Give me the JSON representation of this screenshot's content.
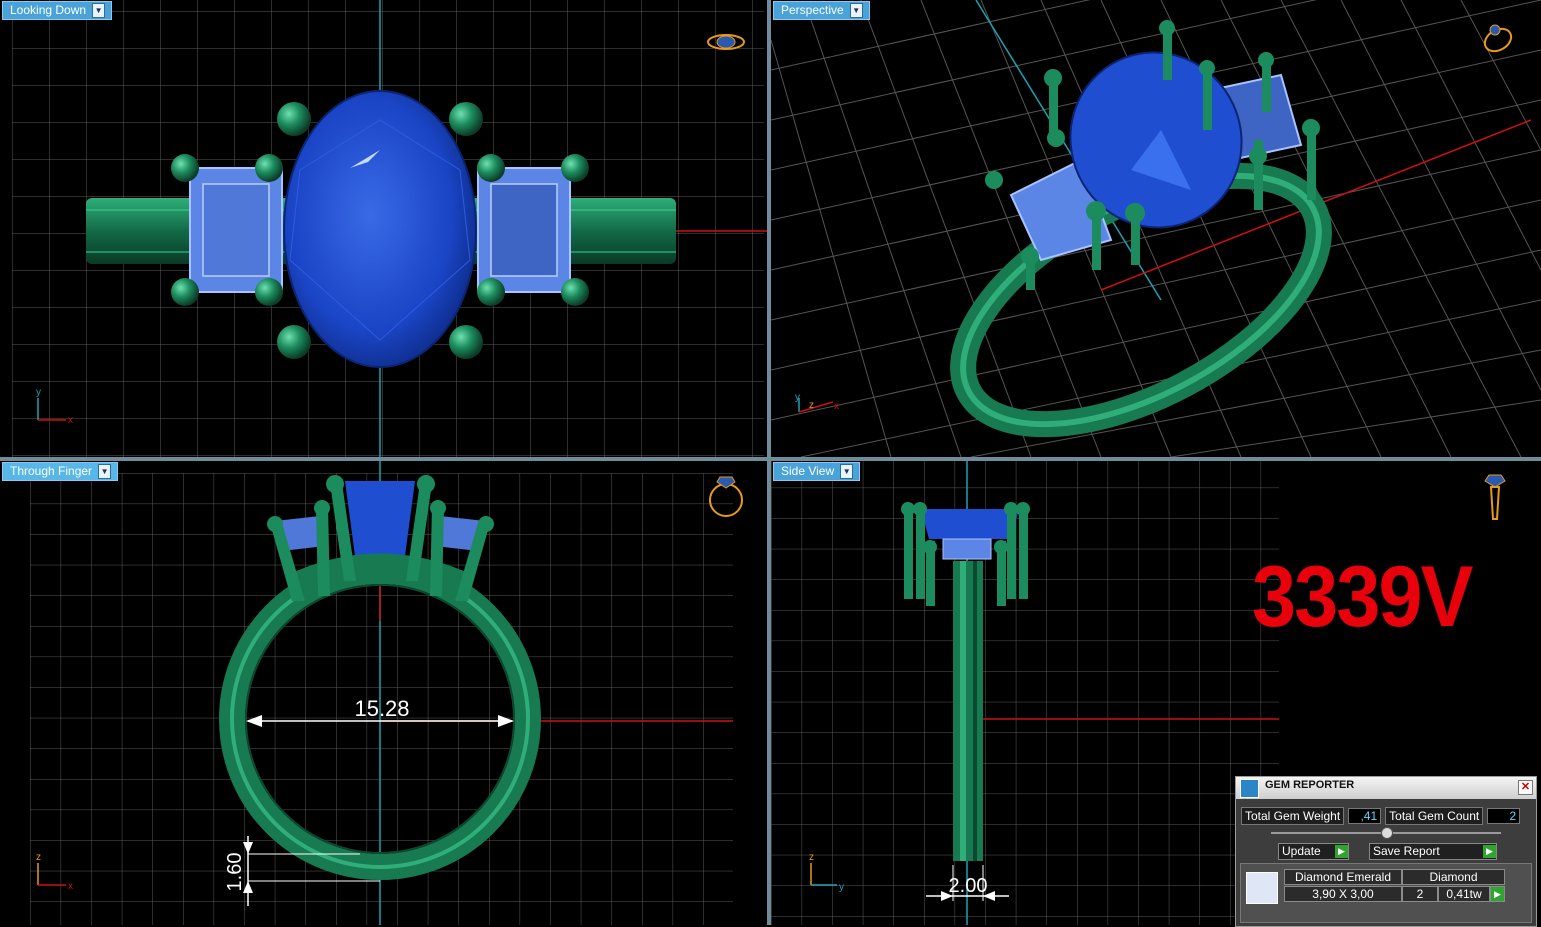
{
  "viewports": {
    "top_left": {
      "label": "Looking Down"
    },
    "top_right": {
      "label": "Perspective"
    },
    "bottom_left": {
      "label": "Through Finger",
      "measure_width": "15.28",
      "measure_thickness": "1.60"
    },
    "bottom_right": {
      "label": "Side View",
      "measure_width": "2.00"
    }
  },
  "axes": {
    "x": "x",
    "y": "y",
    "z": "z"
  },
  "watermark": "3339V",
  "gem_reporter": {
    "title": "GEM REPORTER",
    "close": "✕",
    "total_weight_label": "Total Gem Weight",
    "total_weight_value": ",41",
    "total_count_label": "Total Gem Count",
    "total_count_value": "2",
    "update_label": "Update",
    "save_label": "Save Report",
    "row": {
      "shape": "Diamond Emerald",
      "type": "Diamond",
      "size": "3,90 X 3,00",
      "count": "2",
      "weight": "0,41tw"
    }
  },
  "colors": {
    "metal": "#1f8a5c",
    "gem_center": "#1f4fd0",
    "gem_side": "#5c86e6",
    "grid": "#5a5a5a",
    "axis_x": "#d11010",
    "axis_y": "#1aa3b3",
    "watermark": "#e8000b"
  }
}
